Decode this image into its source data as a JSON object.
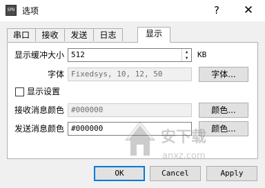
{
  "window": {
    "title": "选项",
    "icon_text": "SPU",
    "help_label": "?",
    "close_label": "✕"
  },
  "tabs": [
    {
      "label": "串口"
    },
    {
      "label": "接收"
    },
    {
      "label": "发送"
    },
    {
      "label": "日志"
    },
    {
      "label": "显示",
      "active": true
    }
  ],
  "display": {
    "buffer_label": "显示缓冲大小",
    "buffer_value": "512",
    "buffer_unit": "KB",
    "font_label": "字体",
    "font_value": "Fixedsys, 10, 12, 50",
    "font_button": "字体...",
    "settings_checkbox_label": "显示设置",
    "settings_checked": false,
    "recv_color_label": "接收消息颜色",
    "recv_color_value": "#000000",
    "recv_color_button": "颜色...",
    "send_color_label": "发送消息颜色",
    "send_color_value": "#000000",
    "send_color_button": "颜色..."
  },
  "footer": {
    "ok_label": "OK",
    "cancel_label": "Cancel",
    "apply_label": "Apply"
  },
  "watermark": {
    "text": "安下载",
    "subtext": "anxz.com"
  }
}
